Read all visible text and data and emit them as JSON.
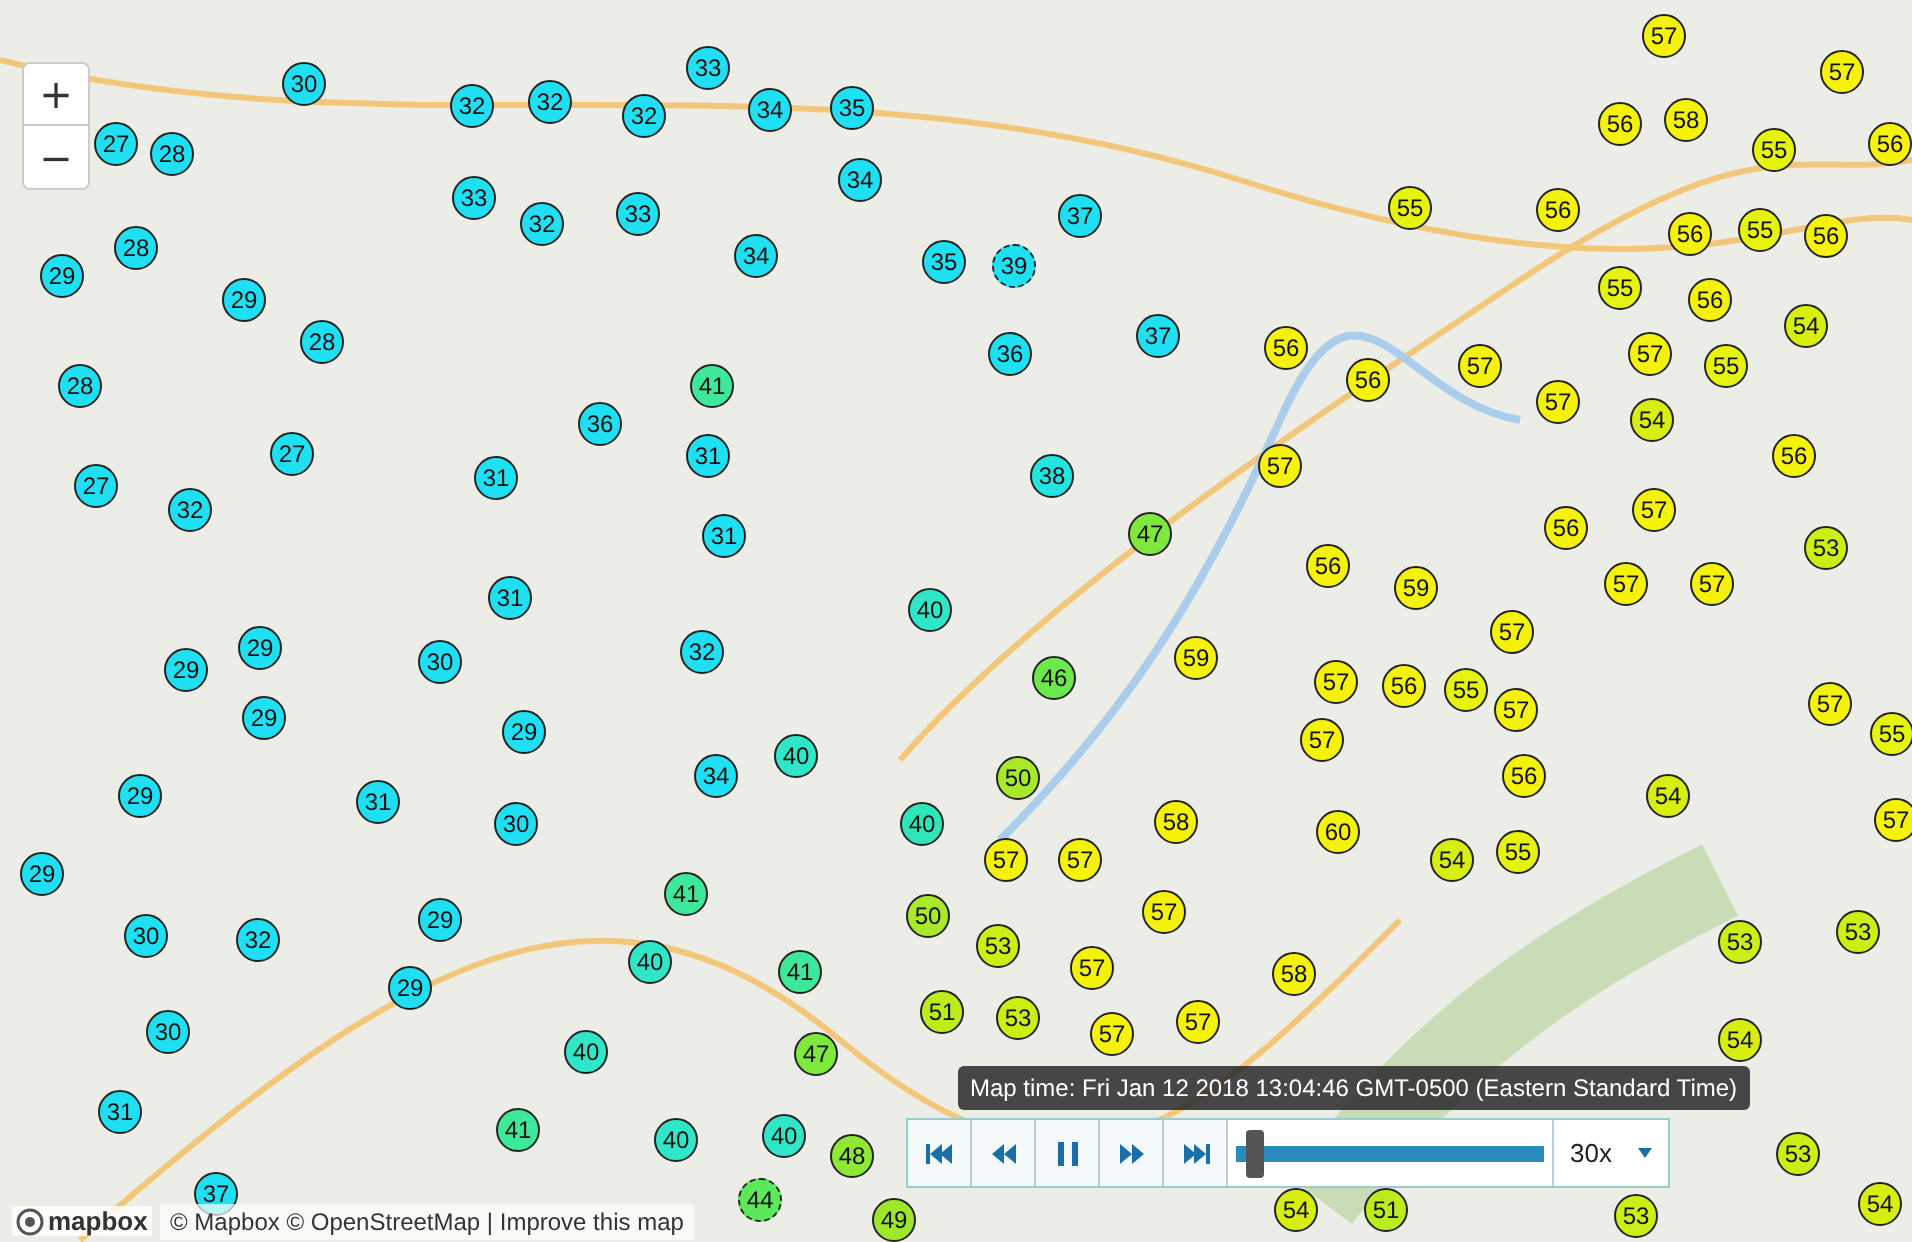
{
  "zoom_controls": {
    "zoom_in": "+",
    "zoom_out": "−"
  },
  "stations": [
    {
      "reading": "30",
      "color": "#1fe0f2",
      "dashed": false
    },
    {
      "reading": "32",
      "color": "#1fe0f2",
      "dashed": false
    },
    {
      "reading": "32",
      "color": "#1fe0f2",
      "dashed": false
    },
    {
      "reading": "33",
      "color": "#1fe0f2",
      "dashed": false
    },
    {
      "reading": "32",
      "color": "#1fe0f2",
      "dashed": false
    },
    {
      "reading": "34",
      "color": "#1fe0f2",
      "dashed": false
    },
    {
      "reading": "35",
      "color": "#1fe0f2",
      "dashed": false
    },
    {
      "reading": "27",
      "color": "#1fe0f2",
      "dashed": false
    },
    {
      "reading": "28",
      "color": "#1fe0f2",
      "dashed": false
    },
    {
      "reading": "33",
      "color": "#1fe0f2",
      "dashed": false
    },
    {
      "reading": "32",
      "color": "#1fe0f2",
      "dashed": false
    },
    {
      "reading": "33",
      "color": "#1fe0f2",
      "dashed": false
    },
    {
      "reading": "34",
      "color": "#1fe0f2",
      "dashed": false
    },
    {
      "reading": "37",
      "color": "#1fe0f2",
      "dashed": false
    },
    {
      "reading": "29",
      "color": "#1fe0f2",
      "dashed": false
    },
    {
      "reading": "28",
      "color": "#1fe0f2",
      "dashed": false
    },
    {
      "reading": "34",
      "color": "#1fe0f2",
      "dashed": false
    },
    {
      "reading": "35",
      "color": "#1fe0f2",
      "dashed": false
    },
    {
      "reading": "39",
      "color": "#1fe0f2",
      "dashed": true
    },
    {
      "reading": "29",
      "color": "#1fe0f2",
      "dashed": false
    },
    {
      "reading": "28",
      "color": "#1fe0f2",
      "dashed": false
    },
    {
      "reading": "28",
      "color": "#1fe0f2",
      "dashed": false
    },
    {
      "reading": "36",
      "color": "#1fe0f2",
      "dashed": false
    },
    {
      "reading": "37",
      "color": "#1fe0f2",
      "dashed": false
    },
    {
      "reading": "41",
      "color": "#3ee89a",
      "dashed": false
    },
    {
      "reading": "36",
      "color": "#1fe0f2",
      "dashed": false
    },
    {
      "reading": "27",
      "color": "#1fe0f2",
      "dashed": false
    },
    {
      "reading": "31",
      "color": "#1fe0f2",
      "dashed": false
    },
    {
      "reading": "31",
      "color": "#1fe0f2",
      "dashed": false
    },
    {
      "reading": "38",
      "color": "#22e4e0",
      "dashed": false
    },
    {
      "reading": "27",
      "color": "#1fe0f2",
      "dashed": false
    },
    {
      "reading": "32",
      "color": "#1fe0f2",
      "dashed": false
    },
    {
      "reading": "31",
      "color": "#1fe0f2",
      "dashed": false
    },
    {
      "reading": "47",
      "color": "#7fe83c",
      "dashed": false
    },
    {
      "reading": "31",
      "color": "#1fe0f2",
      "dashed": false
    },
    {
      "reading": "29",
      "color": "#1fe0f2",
      "dashed": false
    },
    {
      "reading": "30",
      "color": "#1fe0f2",
      "dashed": false
    },
    {
      "reading": "32",
      "color": "#1fe0f2",
      "dashed": false
    },
    {
      "reading": "40",
      "color": "#2fe6c8",
      "dashed": false
    },
    {
      "reading": "46",
      "color": "#6be84a",
      "dashed": false
    },
    {
      "reading": "29",
      "color": "#1fe0f2",
      "dashed": false
    },
    {
      "reading": "29",
      "color": "#1fe0f2",
      "dashed": false
    },
    {
      "reading": "29",
      "color": "#1fe0f2",
      "dashed": false
    },
    {
      "reading": "40",
      "color": "#2fe6c8",
      "dashed": false
    },
    {
      "reading": "34",
      "color": "#1fe0f2",
      "dashed": false
    },
    {
      "reading": "29",
      "color": "#1fe0f2",
      "dashed": false
    },
    {
      "reading": "31",
      "color": "#1fe0f2",
      "dashed": false
    },
    {
      "reading": "30",
      "color": "#1fe0f2",
      "dashed": false
    },
    {
      "reading": "40",
      "color": "#2fe6b8",
      "dashed": false
    },
    {
      "reading": "50",
      "color": "#a8ea2a",
      "dashed": false
    },
    {
      "reading": "29",
      "color": "#1fe0f2",
      "dashed": false
    },
    {
      "reading": "41",
      "color": "#3ee89a",
      "dashed": false
    },
    {
      "reading": "29",
      "color": "#1fe0f2",
      "dashed": false
    },
    {
      "reading": "30",
      "color": "#1fe0f2",
      "dashed": false
    },
    {
      "reading": "32",
      "color": "#1fe0f2",
      "dashed": false
    },
    {
      "reading": "50",
      "color": "#a8ea2a",
      "dashed": false
    },
    {
      "reading": "29",
      "color": "#1fe0f2",
      "dashed": false
    },
    {
      "reading": "40",
      "color": "#2fe6c8",
      "dashed": false
    },
    {
      "reading": "41",
      "color": "#3ee89a",
      "dashed": false
    },
    {
      "reading": "30",
      "color": "#1fe0f2",
      "dashed": false
    },
    {
      "reading": "40",
      "color": "#2fe6c8",
      "dashed": false
    },
    {
      "reading": "47",
      "color": "#7fe83c",
      "dashed": false
    },
    {
      "reading": "31",
      "color": "#1fe0f2",
      "dashed": false
    },
    {
      "reading": "41",
      "color": "#3ee89a",
      "dashed": false
    },
    {
      "reading": "40",
      "color": "#2fe6c8",
      "dashed": false
    },
    {
      "reading": "40",
      "color": "#2fe6c8",
      "dashed": false
    },
    {
      "reading": "48",
      "color": "#8ee834",
      "dashed": false
    },
    {
      "reading": "37",
      "color": "#1fe0f2",
      "dashed": false
    },
    {
      "reading": "44",
      "color": "#5ce85a",
      "dashed": true
    },
    {
      "reading": "49",
      "color": "#9ee82c",
      "dashed": false
    },
    {
      "reading": "57",
      "color": "#f5f20a",
      "dashed": false
    },
    {
      "reading": "57",
      "color": "#f5f20a",
      "dashed": false
    },
    {
      "reading": "56",
      "color": "#f5f20a",
      "dashed": false
    },
    {
      "reading": "58",
      "color": "#f5f20a",
      "dashed": false
    },
    {
      "reading": "55",
      "color": "#e6f40c",
      "dashed": false
    },
    {
      "reading": "56",
      "color": "#f5f20a",
      "dashed": false
    },
    {
      "reading": "55",
      "color": "#e6f40c",
      "dashed": false
    },
    {
      "reading": "56",
      "color": "#f5f20a",
      "dashed": false
    },
    {
      "reading": "56",
      "color": "#f5f20a",
      "dashed": false
    },
    {
      "reading": "55",
      "color": "#e6f40c",
      "dashed": false
    },
    {
      "reading": "56",
      "color": "#f5f20a",
      "dashed": false
    },
    {
      "reading": "55",
      "color": "#e6f40c",
      "dashed": false
    },
    {
      "reading": "56",
      "color": "#f5f20a",
      "dashed": false
    },
    {
      "reading": "54",
      "color": "#d8ee10",
      "dashed": false
    },
    {
      "reading": "56",
      "color": "#f5f20a",
      "dashed": false
    },
    {
      "reading": "56",
      "color": "#f5f20a",
      "dashed": false
    },
    {
      "reading": "57",
      "color": "#f5f20a",
      "dashed": false
    },
    {
      "reading": "57",
      "color": "#f5f20a",
      "dashed": false
    },
    {
      "reading": "57",
      "color": "#f5f20a",
      "dashed": false
    },
    {
      "reading": "55",
      "color": "#e6f40c",
      "dashed": false
    },
    {
      "reading": "57",
      "color": "#f5f20a",
      "dashed": false
    },
    {
      "reading": "54",
      "color": "#d8ee10",
      "dashed": false
    },
    {
      "reading": "56",
      "color": "#f5f20a",
      "dashed": false
    },
    {
      "reading": "56",
      "color": "#f5f20a",
      "dashed": false
    },
    {
      "reading": "57",
      "color": "#f5f20a",
      "dashed": false
    },
    {
      "reading": "53",
      "color": "#cdee12",
      "dashed": false
    },
    {
      "reading": "56",
      "color": "#f5f20a",
      "dashed": false
    },
    {
      "reading": "59",
      "color": "#f5f20a",
      "dashed": false
    },
    {
      "reading": "57",
      "color": "#f5f20a",
      "dashed": false
    },
    {
      "reading": "57",
      "color": "#f5f20a",
      "dashed": false
    },
    {
      "reading": "59",
      "color": "#f5f20a",
      "dashed": false
    },
    {
      "reading": "57",
      "color": "#f5f20a",
      "dashed": false
    },
    {
      "reading": "56",
      "color": "#f5f20a",
      "dashed": false
    },
    {
      "reading": "57",
      "color": "#f5f20a",
      "dashed": false
    },
    {
      "reading": "55",
      "color": "#e6f40c",
      "dashed": false
    },
    {
      "reading": "57",
      "color": "#f5f20a",
      "dashed": false
    },
    {
      "reading": "57",
      "color": "#f5f20a",
      "dashed": false
    },
    {
      "reading": "57",
      "color": "#f5f20a",
      "dashed": false
    },
    {
      "reading": "55",
      "color": "#e6f40c",
      "dashed": false
    },
    {
      "reading": "56",
      "color": "#f5f20a",
      "dashed": false
    },
    {
      "reading": "58",
      "color": "#f5f20a",
      "dashed": false
    },
    {
      "reading": "60",
      "color": "#f5f20a",
      "dashed": false
    },
    {
      "reading": "54",
      "color": "#d8ee10",
      "dashed": false
    },
    {
      "reading": "57",
      "color": "#f5f20a",
      "dashed": false
    },
    {
      "reading": "57",
      "color": "#f5f20a",
      "dashed": false
    },
    {
      "reading": "57",
      "color": "#f5f20a",
      "dashed": false
    },
    {
      "reading": "54",
      "color": "#d8ee10",
      "dashed": false
    },
    {
      "reading": "55",
      "color": "#e6f40c",
      "dashed": false
    },
    {
      "reading": "57",
      "color": "#f5f20a",
      "dashed": false
    },
    {
      "reading": "53",
      "color": "#cdee12",
      "dashed": false
    },
    {
      "reading": "53",
      "color": "#cdee12",
      "dashed": false
    },
    {
      "reading": "53",
      "color": "#cdee12",
      "dashed": false
    },
    {
      "reading": "57",
      "color": "#f5f20a",
      "dashed": false
    },
    {
      "reading": "58",
      "color": "#f5f20a",
      "dashed": false
    },
    {
      "reading": "51",
      "color": "#bdec1c",
      "dashed": false
    },
    {
      "reading": "53",
      "color": "#cdee12",
      "dashed": false
    },
    {
      "reading": "57",
      "color": "#f5f20a",
      "dashed": false
    },
    {
      "reading": "57",
      "color": "#f5f20a",
      "dashed": false
    },
    {
      "reading": "54",
      "color": "#d8ee10",
      "dashed": false
    },
    {
      "reading": "53",
      "color": "#cdee12",
      "dashed": false
    },
    {
      "reading": "54",
      "color": "#d8ee10",
      "dashed": false
    },
    {
      "reading": "51",
      "color": "#bdec1c",
      "dashed": false
    },
    {
      "reading": "53",
      "color": "#cdee12",
      "dashed": false
    },
    {
      "reading": "54",
      "color": "#d8ee10",
      "dashed": false
    }
  ],
  "playback": {
    "map_time": "Map time: Fri Jan 12 2018 13:04:46 GMT-0500 (Eastern Standard Time)",
    "level": 0.03,
    "speed": "30x"
  },
  "attribution": {
    "logo": "mapbox",
    "text": "© Mapbox © OpenStreetMap | Improve this map"
  }
}
